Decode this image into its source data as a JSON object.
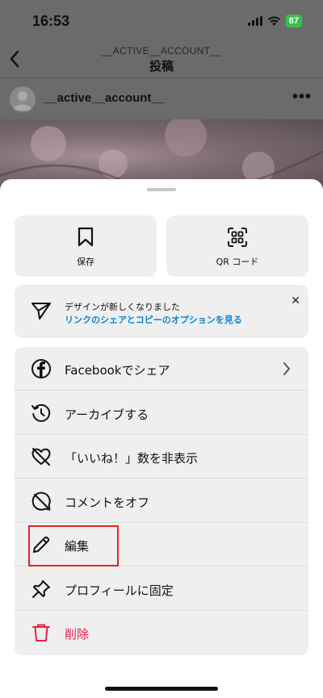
{
  "status_bar": {
    "time": "16:53",
    "battery": "87"
  },
  "header": {
    "account": "__ACTIVE__ACCOUNT__",
    "title": "投稿"
  },
  "post": {
    "username": "__active__account__"
  },
  "sheet": {
    "save_label": "保存",
    "qr_label": "QR コード",
    "notice": {
      "line1": "デザインが新しくなりました",
      "link": "リンクのシェアとコピーのオプションを見る"
    },
    "menu": [
      {
        "label": "Facebookでシェア",
        "icon": "facebook-icon"
      },
      {
        "label": "アーカイブする",
        "icon": "archive-history-icon"
      },
      {
        "label": "「いいね！」数を非表示",
        "icon": "heart-slash-icon"
      },
      {
        "label": "コメントをオフ",
        "icon": "comment-off-icon"
      },
      {
        "label": "編集",
        "icon": "pencil-icon"
      },
      {
        "label": "プロフィールに固定",
        "icon": "pin-icon"
      },
      {
        "label": "削除",
        "icon": "trash-icon"
      }
    ]
  },
  "colors": {
    "accent_link": "#0a86d8",
    "danger": "#ed1f4a",
    "highlight": "#e0242a"
  }
}
